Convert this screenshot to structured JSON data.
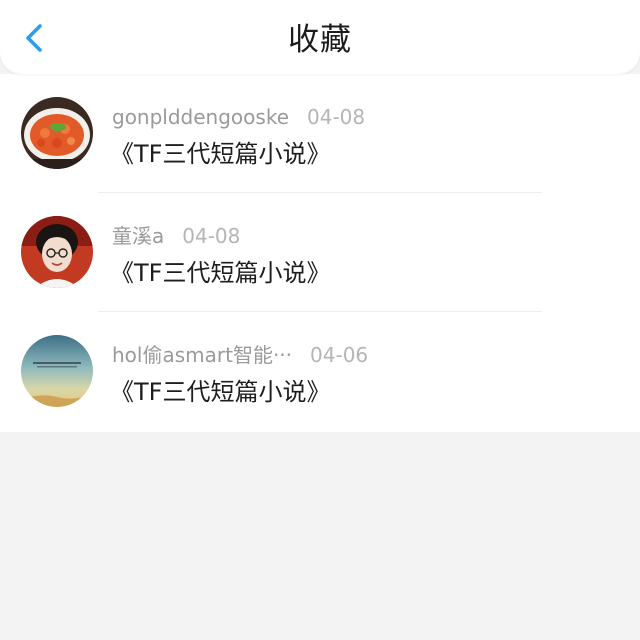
{
  "header": {
    "title": "收藏",
    "back_icon": "chevron-left-icon",
    "accent_color": "#2d9cf0"
  },
  "items": [
    {
      "username": "gonplddengooske",
      "date": "04-08",
      "title": "《TF三代短篇小说》",
      "avatar": "food-dish-avatar"
    },
    {
      "username": "童溪a",
      "date": "04-08",
      "title": "《TF三代短篇小说》",
      "avatar": "person-portrait-avatar"
    },
    {
      "username": "hol偷asmart智能···",
      "date": "04-06",
      "title": "《TF三代短篇小说》",
      "avatar": "sky-landscape-avatar"
    }
  ]
}
